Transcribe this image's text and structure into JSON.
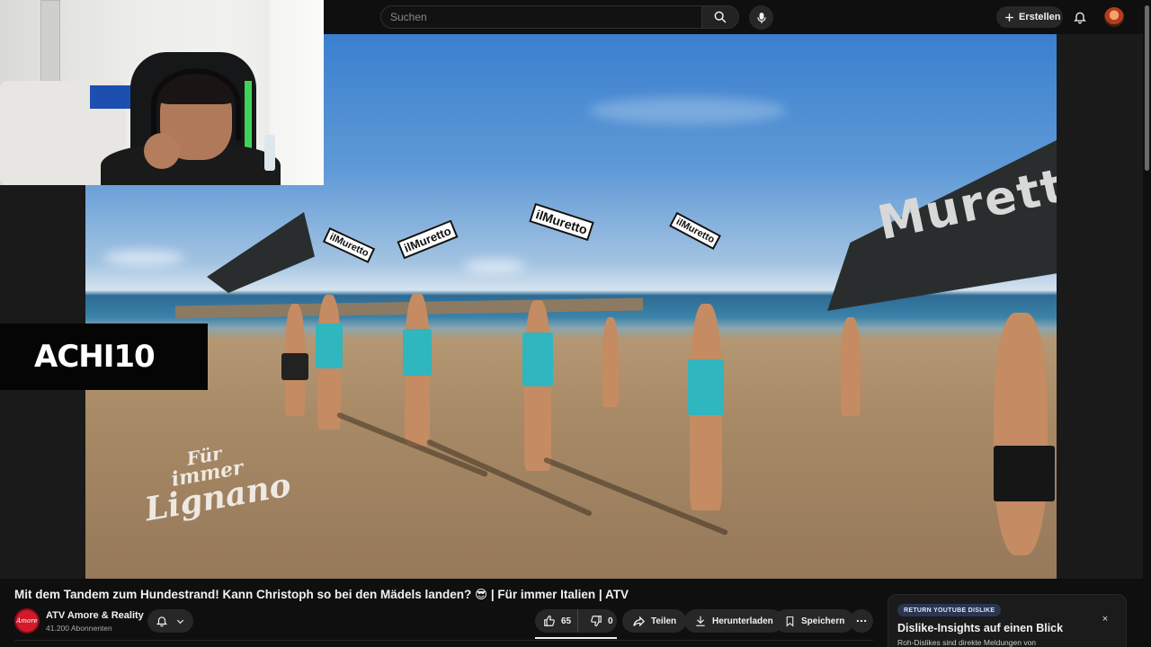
{
  "search": {
    "placeholder": "Suchen"
  },
  "header": {
    "create_label": "Erstellen"
  },
  "video": {
    "streamer_overlay": "ACHI10",
    "flag_text": "Murett",
    "sign_text": "ilMuretto",
    "watermark": {
      "line1": "Für",
      "line2": "immer",
      "line3": "Lignano"
    }
  },
  "title": "Mit dem Tandem zum Hundestrand! Kann Christoph so bei den Mädels landen? 😎 | Für immer Italien | ATV",
  "channel": {
    "avatar_text": "Amore",
    "name": "ATV Amore & Reality",
    "subscribers": "41.200 Abonnenten"
  },
  "actions": {
    "likes": "65",
    "dislikes": "0",
    "share": "Teilen",
    "download": "Herunterladen",
    "save": "Speichern"
  },
  "dislike_panel": {
    "badge": "RETURN YOUTUBE DISLIKE",
    "title": "Dislike-Insights auf einen Blick",
    "text": "Roh-Dislikes sind direkte Meldungen von",
    "close": "×"
  },
  "colors": {
    "background": "#0f0f0f",
    "pill": "#272727",
    "channel_avatar": "#d11a2a",
    "badge": "#2a3550"
  },
  "icons": [
    "search-icon",
    "mic-icon",
    "plus-icon",
    "bell-icon",
    "thumb-up-icon",
    "thumb-down-icon",
    "share-icon",
    "download-icon",
    "bookmark-icon",
    "more-icon",
    "chevron-down-icon"
  ]
}
